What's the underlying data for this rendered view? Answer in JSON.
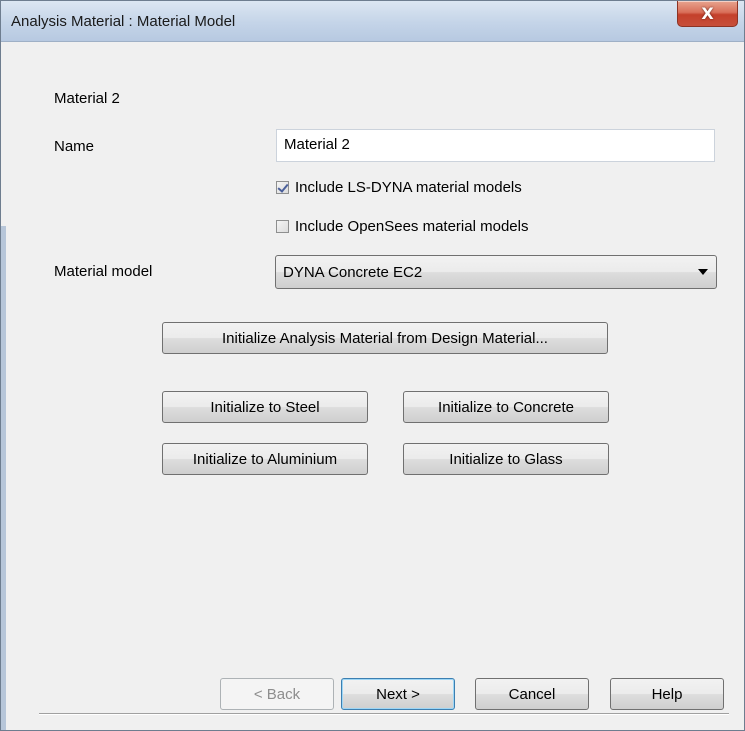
{
  "window": {
    "title": "Analysis Material : Material Model",
    "close_glyph": "X"
  },
  "form": {
    "material_heading": "Material 2",
    "name_label": "Name",
    "name_value": "Material 2",
    "include_lsdyna_label": "Include LS-DYNA material models",
    "include_lsdyna_checked": true,
    "include_opensees_label": "Include OpenSees material models",
    "include_opensees_checked": false,
    "material_model_label": "Material model",
    "material_model_value": "DYNA Concrete EC2"
  },
  "buttons": {
    "init_from_design": "Initialize Analysis Material from Design Material...",
    "init_steel": "Initialize to Steel",
    "init_concrete": "Initialize to Concrete",
    "init_aluminium": "Initialize to Aluminium",
    "init_glass": "Initialize to Glass"
  },
  "footer": {
    "back": "< Back",
    "next": "Next >",
    "cancel": "Cancel",
    "help": "Help"
  },
  "icons": {
    "close": "close-icon",
    "dropdown": "chevron-down-icon",
    "checkbox": "checkbox-icon"
  }
}
